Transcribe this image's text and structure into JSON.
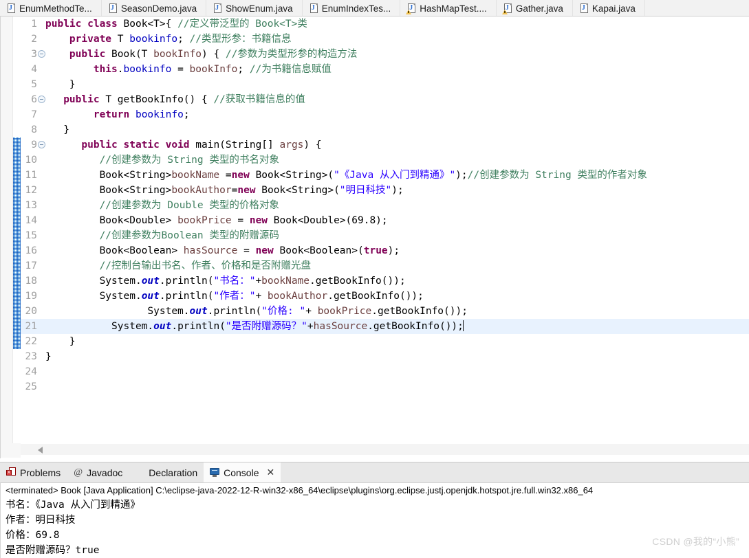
{
  "editor_tabs": [
    {
      "label": "EnumMethodTe...",
      "icon": "java-file-icon",
      "warning": false,
      "active": false
    },
    {
      "label": "SeasonDemo.java",
      "icon": "java-file-icon",
      "warning": false,
      "active": false
    },
    {
      "label": "ShowEnum.java",
      "icon": "java-file-icon",
      "warning": false,
      "active": false
    },
    {
      "label": "EnumIndexTes...",
      "icon": "java-file-icon",
      "warning": false,
      "active": false
    },
    {
      "label": "HashMapTest....",
      "icon": "java-file-warning-icon",
      "warning": true,
      "active": false
    },
    {
      "label": "Gather.java",
      "icon": "java-file-warning-icon",
      "warning": true,
      "active": false
    },
    {
      "label": "Kapai.java",
      "icon": "java-file-icon",
      "warning": false,
      "active": false
    }
  ],
  "code": {
    "current_line": 21,
    "change_bar_from": 9,
    "change_bar_to": 22,
    "lines": [
      {
        "n": "1",
        "fold": false,
        "tokens": [
          {
            "t": "kw",
            "v": "public class "
          },
          {
            "t": "plain",
            "v": "Book<T>{ "
          },
          {
            "t": "cmt",
            "v": "//定义带泛型的 Book<T>类"
          }
        ]
      },
      {
        "n": "2",
        "fold": false,
        "tokens": [
          {
            "t": "plain",
            "v": "    "
          },
          {
            "t": "kw",
            "v": "private"
          },
          {
            "t": "plain",
            "v": " T "
          },
          {
            "t": "fld",
            "v": "bookinfo"
          },
          {
            "t": "plain",
            "v": "; "
          },
          {
            "t": "cmt",
            "v": "//类型形参：书籍信息"
          }
        ]
      },
      {
        "n": "3",
        "fold": true,
        "tokens": [
          {
            "t": "plain",
            "v": "    "
          },
          {
            "t": "kw",
            "v": "public "
          },
          {
            "t": "plain",
            "v": "Book(T "
          },
          {
            "t": "loc",
            "v": "bookInfo"
          },
          {
            "t": "plain",
            "v": ") { "
          },
          {
            "t": "cmt",
            "v": "//参数为类型形参的构造方法"
          }
        ]
      },
      {
        "n": "4",
        "fold": false,
        "tokens": [
          {
            "t": "plain",
            "v": "        "
          },
          {
            "t": "kw",
            "v": "this"
          },
          {
            "t": "plain",
            "v": "."
          },
          {
            "t": "fld",
            "v": "bookinfo"
          },
          {
            "t": "plain",
            "v": " = "
          },
          {
            "t": "loc",
            "v": "bookInfo"
          },
          {
            "t": "plain",
            "v": "; "
          },
          {
            "t": "cmt",
            "v": "//为书籍信息赋值"
          }
        ]
      },
      {
        "n": "5",
        "fold": false,
        "tokens": [
          {
            "t": "plain",
            "v": "    }"
          }
        ]
      },
      {
        "n": "6",
        "fold": true,
        "tokens": [
          {
            "t": "plain",
            "v": "   "
          },
          {
            "t": "kw",
            "v": "public "
          },
          {
            "t": "plain",
            "v": "T getBookInfo() { "
          },
          {
            "t": "cmt",
            "v": "//获取书籍信息的值"
          }
        ]
      },
      {
        "n": "7",
        "fold": false,
        "tokens": [
          {
            "t": "plain",
            "v": "        "
          },
          {
            "t": "kw",
            "v": "return"
          },
          {
            "t": "plain",
            "v": " "
          },
          {
            "t": "fld",
            "v": "bookinfo"
          },
          {
            "t": "plain",
            "v": ";"
          }
        ]
      },
      {
        "n": "8",
        "fold": false,
        "tokens": [
          {
            "t": "plain",
            "v": "   }"
          }
        ]
      },
      {
        "n": "9",
        "fold": true,
        "tokens": [
          {
            "t": "plain",
            "v": "      "
          },
          {
            "t": "kw",
            "v": "public static void "
          },
          {
            "t": "plain",
            "v": "main(String[] "
          },
          {
            "t": "loc",
            "v": "args"
          },
          {
            "t": "plain",
            "v": ") {"
          }
        ]
      },
      {
        "n": "10",
        "fold": false,
        "tokens": [
          {
            "t": "plain",
            "v": "         "
          },
          {
            "t": "cmt",
            "v": "//创建参数为 String 类型的书名对象"
          }
        ]
      },
      {
        "n": "11",
        "fold": false,
        "tokens": [
          {
            "t": "plain",
            "v": "         Book<String>"
          },
          {
            "t": "loc",
            "v": "bookName"
          },
          {
            "t": "plain",
            "v": " ="
          },
          {
            "t": "kw",
            "v": "new"
          },
          {
            "t": "plain",
            "v": " Book<String>("
          },
          {
            "t": "str",
            "v": "\"《Java 从入门到精通》\""
          },
          {
            "t": "plain",
            "v": ");"
          },
          {
            "t": "cmt",
            "v": "//创建参数为 String 类型的作者对象"
          }
        ]
      },
      {
        "n": "12",
        "fold": false,
        "tokens": [
          {
            "t": "plain",
            "v": "         Book<String>"
          },
          {
            "t": "loc",
            "v": "bookAuthor"
          },
          {
            "t": "plain",
            "v": "="
          },
          {
            "t": "kw",
            "v": "new"
          },
          {
            "t": "plain",
            "v": " Book<String>("
          },
          {
            "t": "str",
            "v": "\"明日科技\""
          },
          {
            "t": "plain",
            "v": ");"
          }
        ]
      },
      {
        "n": "13",
        "fold": false,
        "tokens": [
          {
            "t": "plain",
            "v": "         "
          },
          {
            "t": "cmt",
            "v": "//创建参数为 Double 类型的价格对象"
          }
        ]
      },
      {
        "n": "14",
        "fold": false,
        "tokens": [
          {
            "t": "plain",
            "v": "         Book<Double> "
          },
          {
            "t": "loc",
            "v": "bookPrice"
          },
          {
            "t": "plain",
            "v": " = "
          },
          {
            "t": "kw",
            "v": "new"
          },
          {
            "t": "plain",
            "v": " Book<Double>(69.8);"
          }
        ]
      },
      {
        "n": "15",
        "fold": false,
        "tokens": [
          {
            "t": "plain",
            "v": "         "
          },
          {
            "t": "cmt",
            "v": "//创建参数为Boolean 类型的附赠源码"
          }
        ]
      },
      {
        "n": "16",
        "fold": false,
        "tokens": [
          {
            "t": "plain",
            "v": "         Book<Boolean> "
          },
          {
            "t": "loc",
            "v": "hasSource"
          },
          {
            "t": "plain",
            "v": " = "
          },
          {
            "t": "kw",
            "v": "new"
          },
          {
            "t": "plain",
            "v": " Book<Boolean>("
          },
          {
            "t": "kw",
            "v": "true"
          },
          {
            "t": "plain",
            "v": ");"
          }
        ]
      },
      {
        "n": "17",
        "fold": false,
        "tokens": [
          {
            "t": "plain",
            "v": "         "
          },
          {
            "t": "cmt",
            "v": "//控制台输出书名、作者、价格和是否附赠光盘"
          }
        ]
      },
      {
        "n": "18",
        "fold": false,
        "tokens": [
          {
            "t": "plain",
            "v": "         System."
          },
          {
            "t": "stat",
            "v": "out"
          },
          {
            "t": "plain",
            "v": ".println("
          },
          {
            "t": "str",
            "v": "\"书名：\""
          },
          {
            "t": "plain",
            "v": "+"
          },
          {
            "t": "loc",
            "v": "bookName"
          },
          {
            "t": "plain",
            "v": ".getBookInfo());"
          }
        ]
      },
      {
        "n": "19",
        "fold": false,
        "tokens": [
          {
            "t": "plain",
            "v": "         System."
          },
          {
            "t": "stat",
            "v": "out"
          },
          {
            "t": "plain",
            "v": ".println("
          },
          {
            "t": "str",
            "v": "\"作者：\""
          },
          {
            "t": "plain",
            "v": "+ "
          },
          {
            "t": "loc",
            "v": "bookAuthor"
          },
          {
            "t": "plain",
            "v": ".getBookInfo());"
          }
        ]
      },
      {
        "n": "20",
        "fold": false,
        "tokens": [
          {
            "t": "plain",
            "v": "                 System."
          },
          {
            "t": "stat",
            "v": "out"
          },
          {
            "t": "plain",
            "v": ".println("
          },
          {
            "t": "str",
            "v": "\"价格: \""
          },
          {
            "t": "plain",
            "v": "+ "
          },
          {
            "t": "loc",
            "v": "bookPrice"
          },
          {
            "t": "plain",
            "v": ".getBookInfo());"
          }
        ]
      },
      {
        "n": "21",
        "fold": false,
        "tokens": [
          {
            "t": "plain",
            "v": "           System."
          },
          {
            "t": "stat",
            "v": "out"
          },
          {
            "t": "plain",
            "v": ".println("
          },
          {
            "t": "str",
            "v": "\"是否附赠源码？\""
          },
          {
            "t": "plain",
            "v": "+"
          },
          {
            "t": "loc",
            "v": "hasSource"
          },
          {
            "t": "plain",
            "v": ".getBookInfo());"
          }
        ]
      },
      {
        "n": "22",
        "fold": false,
        "tokens": [
          {
            "t": "plain",
            "v": "    }"
          }
        ]
      },
      {
        "n": "23",
        "fold": false,
        "tokens": [
          {
            "t": "plain",
            "v": "}"
          }
        ]
      },
      {
        "n": "24",
        "fold": false,
        "tokens": []
      },
      {
        "n": "25",
        "fold": false,
        "tokens": []
      }
    ]
  },
  "view_tabs": [
    {
      "label": "Problems",
      "icon": "problems-icon",
      "active": false,
      "closable": false
    },
    {
      "label": "Javadoc",
      "icon": "javadoc-icon",
      "active": false,
      "closable": false
    },
    {
      "label": "Declaration",
      "icon": "declaration-icon",
      "active": false,
      "closable": false
    },
    {
      "label": "Console",
      "icon": "console-icon",
      "active": true,
      "closable": true,
      "close_label": "✕"
    }
  ],
  "console": {
    "status_line": "<terminated> Book [Java Application] C:\\eclipse-java-2022-12-R-win32-x86_64\\eclipse\\plugins\\org.eclipse.justj.openjdk.hotspot.jre.full.win32.x86_64",
    "output": [
      "书名：《Java 从入门到精通》",
      "作者：明日科技",
      "价格：69.8",
      "是否附赠源码？true"
    ]
  },
  "watermark": "CSDN @我的“小熊”",
  "colors": {
    "keyword": "#7f0055",
    "comment": "#3f7f5f",
    "string": "#2a00ff",
    "field": "#0000c0",
    "local": "#6a3e3e",
    "current_line": "#e8f2fe",
    "change_bar": "#1a7fd4"
  }
}
